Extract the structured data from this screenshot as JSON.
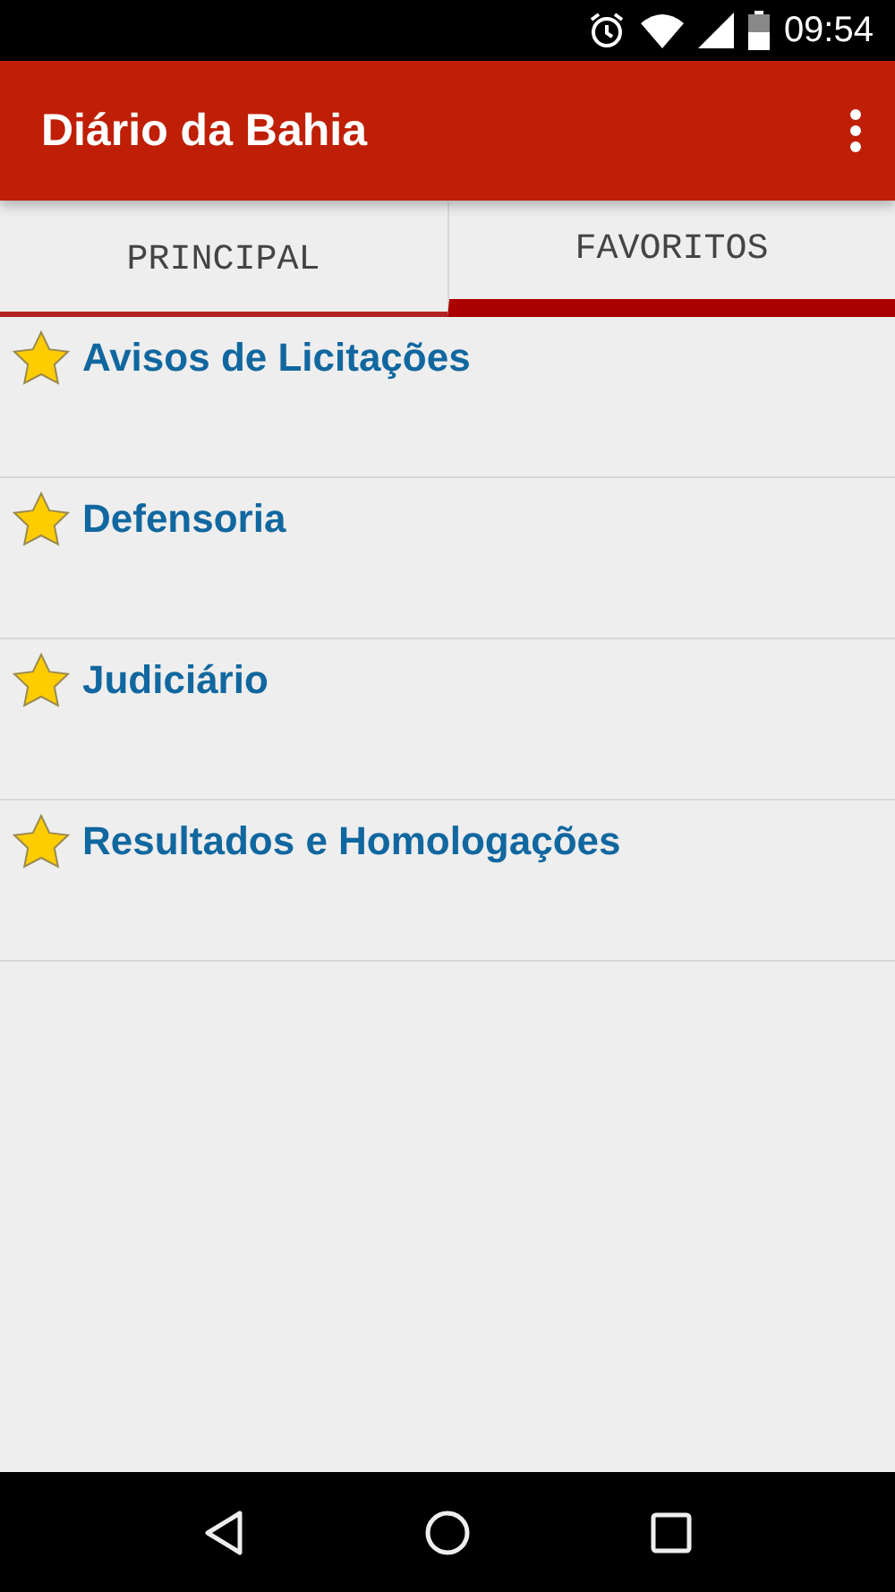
{
  "status_bar": {
    "time": "09:54"
  },
  "app_bar": {
    "title": "Diário da Bahia"
  },
  "tabs": [
    {
      "label": "PRINCIPAL",
      "selected": false
    },
    {
      "label": "FAVORITOS",
      "selected": true
    }
  ],
  "items": [
    {
      "label": "Avisos de Licitações"
    },
    {
      "label": "Defensoria"
    },
    {
      "label": "Judiciário"
    },
    {
      "label": "Resultados e Homologações"
    }
  ]
}
